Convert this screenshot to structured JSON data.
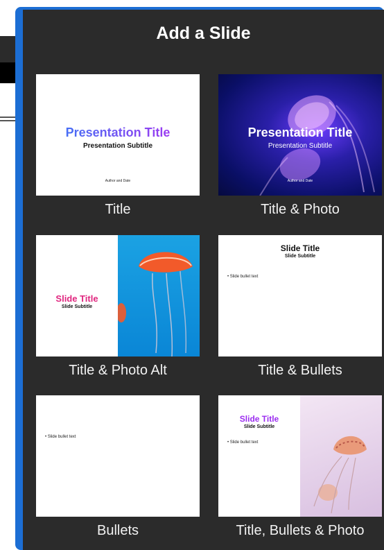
{
  "dialog": {
    "title": "Add a Slide"
  },
  "layouts": [
    {
      "label": "Title",
      "thumb": {
        "title": "Presentation Title",
        "subtitle": "Presentation Subtitle",
        "author": "Author and Date"
      }
    },
    {
      "label": "Title & Photo",
      "thumb": {
        "title": "Presentation Title",
        "subtitle": "Presentation Subtitle",
        "author": "Author and Date"
      }
    },
    {
      "label": "Title & Photo Alt",
      "thumb": {
        "title": "Slide Title",
        "subtitle": "Slide Subtitle"
      }
    },
    {
      "label": "Title & Bullets",
      "thumb": {
        "title": "Slide Title",
        "subtitle": "Slide Subtitle",
        "bullet": "• Slide bullet text"
      }
    },
    {
      "label": "Bullets",
      "thumb": {
        "bullet": "• Slide bullet text"
      }
    },
    {
      "label": "Title, Bullets & Photo",
      "thumb": {
        "title": "Slide Title",
        "subtitle": "Slide Subtitle",
        "bullet": "• Slide bullet text"
      }
    }
  ],
  "colors": {
    "panel_bg": "#2b2b2b",
    "accent_border": "#1c6ed4",
    "gradient_title_start": "#2f7df6",
    "gradient_title_end": "#b42cf0",
    "pink_title": "#e0267f",
    "purple_title": "#9b2cf0"
  }
}
